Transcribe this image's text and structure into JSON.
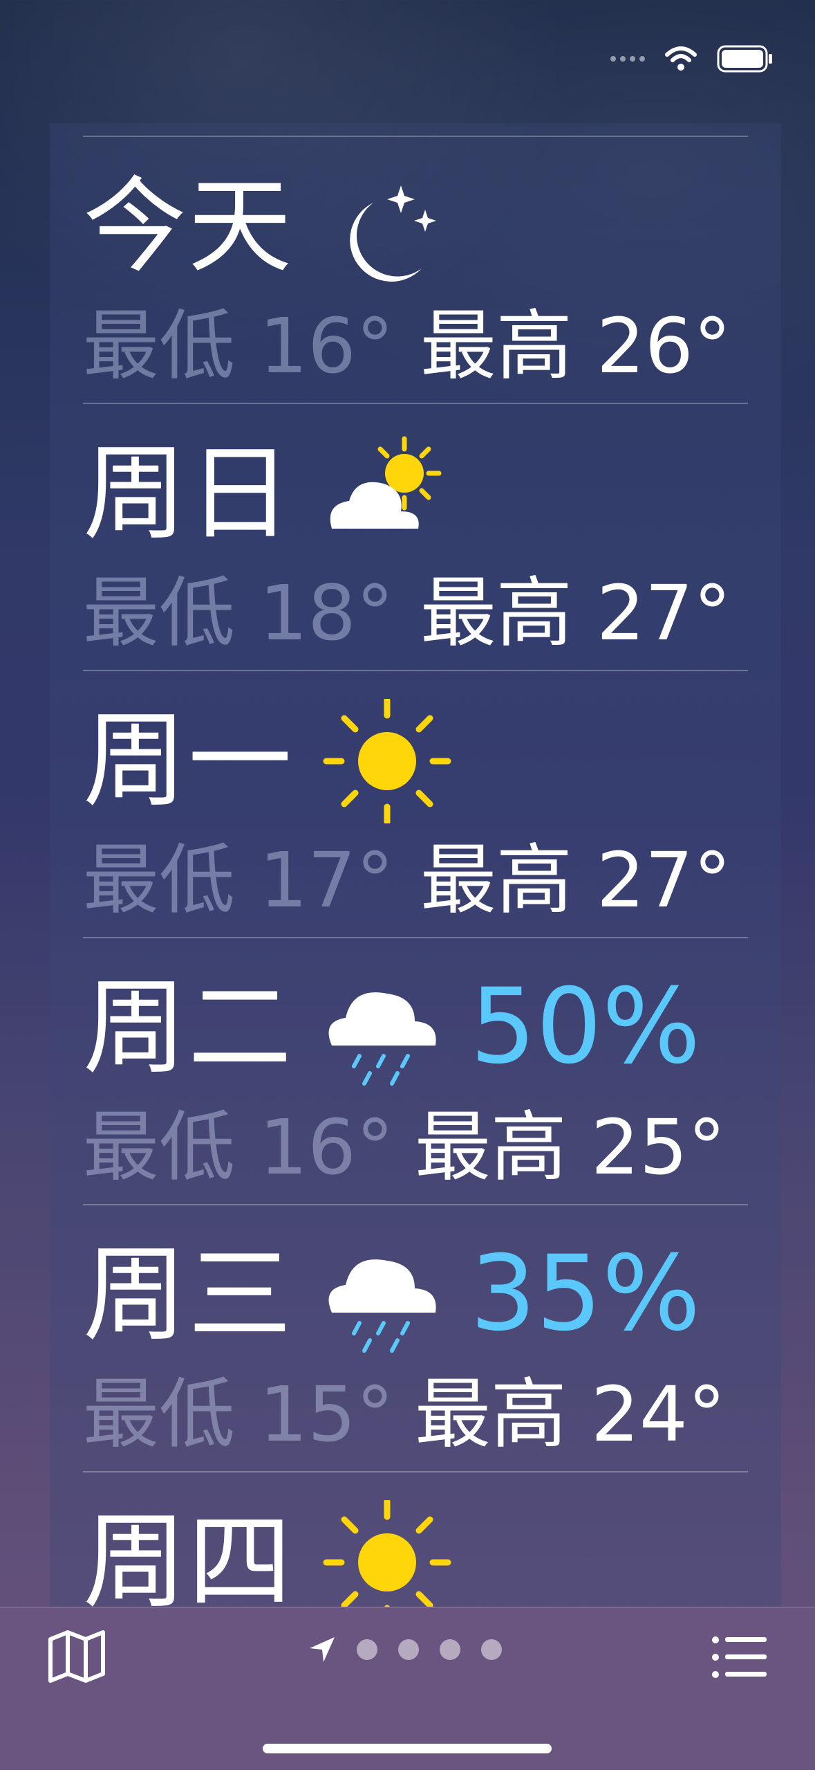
{
  "forecast": [
    {
      "day": "今天",
      "icon": "moon-stars-icon",
      "low": "最低 16°",
      "high": "最高 26°",
      "precip": ""
    },
    {
      "day": "周日",
      "icon": "partly-sunny-cloud-icon",
      "low": "最低 18°",
      "high": "最高 27°",
      "precip": ""
    },
    {
      "day": "周一",
      "icon": "sun-icon",
      "low": "最低 17°",
      "high": "最高 27°",
      "precip": ""
    },
    {
      "day": "周二",
      "icon": "rain-cloud-icon",
      "low": "最低 16°",
      "high": "最高 25°",
      "precip": "50%"
    },
    {
      "day": "周三",
      "icon": "rain-cloud-icon",
      "low": "最低 15°",
      "high": "最高 24°",
      "precip": "35%"
    },
    {
      "day": "周四",
      "icon": "sun-icon",
      "low": "",
      "high": "",
      "precip": ""
    }
  ],
  "colors": {
    "precip": "#5ac8fa",
    "sun": "#ffd60a"
  },
  "toolbar": {
    "pages": 4
  }
}
